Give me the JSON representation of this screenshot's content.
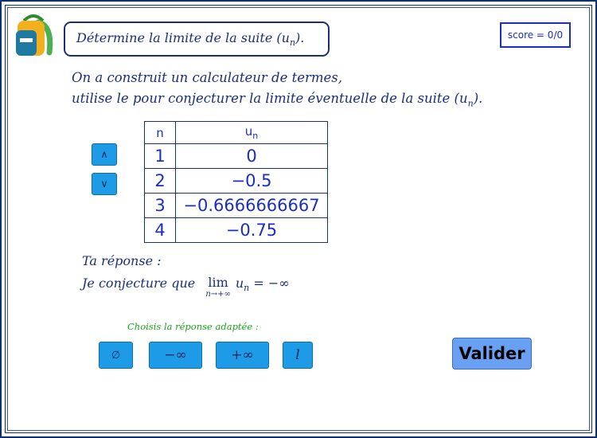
{
  "header": {
    "title_prefix": "Détermine la limite de la suite (u",
    "title_sub": "n",
    "title_suffix": ").",
    "score": "score = 0/0"
  },
  "intro": {
    "line1": "On a construit un calculateur de termes,",
    "line2_prefix": "utilise le pour conjecturer la limite éventuelle de la suite (u",
    "line2_sub": "n",
    "line2_suffix": ")."
  },
  "nav": {
    "up_symbol": "∧",
    "down_symbol": "∨"
  },
  "table": {
    "header_n": "n",
    "header_u": "u",
    "header_u_sub": "n",
    "rows": [
      {
        "n": "1",
        "u": "0"
      },
      {
        "n": "2",
        "u": "−0.5"
      },
      {
        "n": "3",
        "u": "−0.6666666667"
      },
      {
        "n": "4",
        "u": "−0.75"
      }
    ]
  },
  "answer": {
    "label": "Ta réponse :",
    "conjecture": "Je conjecture que",
    "lim": "lim",
    "lim_under": "n→+∞",
    "u": "u",
    "u_sub": "n",
    "result": "= −∞"
  },
  "choices": {
    "prompt": "Choisis la réponse adaptée :",
    "empty": "∅",
    "minus_inf": "−∞",
    "plus_inf": "+∞",
    "l": "l"
  },
  "validate_label": "Valider",
  "colors": {
    "navy": "#1a2f7a",
    "button_blue": "#1e9be6",
    "valider_blue": "#6aa0f2",
    "prompt_green": "#1aa21a"
  }
}
